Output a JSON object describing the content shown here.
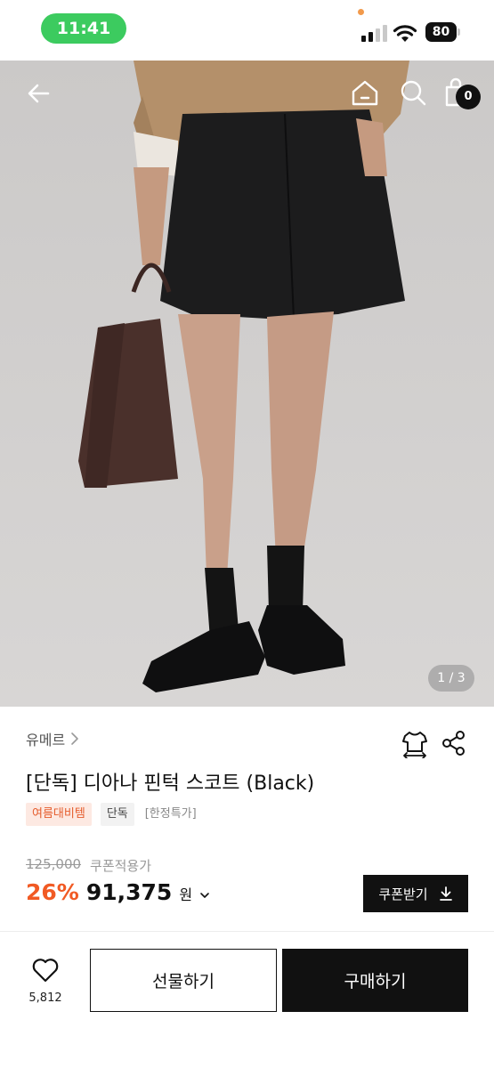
{
  "status_bar": {
    "time": "11:41",
    "battery": "80"
  },
  "hero": {
    "cart_count": "0",
    "page_indicator": "1 / 3"
  },
  "product": {
    "brand": "유메르",
    "title": "[단독] 디아나 핀턱 스코트 (Black)",
    "tags": [
      "여름대비템",
      "단독",
      "[한정특가]"
    ],
    "original_price": "125,000",
    "coupon_note": "쿠폰적용가",
    "discount": "26%",
    "price": "91,375",
    "currency": "원",
    "coupon_button": "쿠폰받기"
  },
  "bottom_bar": {
    "like_count": "5,812",
    "gift_label": "선물하기",
    "buy_label": "구매하기"
  },
  "icons": {
    "back": "arrow-left-icon",
    "home": "home-icon",
    "search": "search-icon",
    "cart": "shopping-bag-icon",
    "closet": "shirt-icon",
    "share": "share-icon",
    "download": "download-icon",
    "heart": "heart-icon"
  },
  "colors": {
    "status_green": "#3ccb5f",
    "discount_orange": "#f15a24",
    "tag_orange_bg": "#fde9e2",
    "tag_orange_text": "#e55d2e",
    "primary_black": "#111111"
  }
}
